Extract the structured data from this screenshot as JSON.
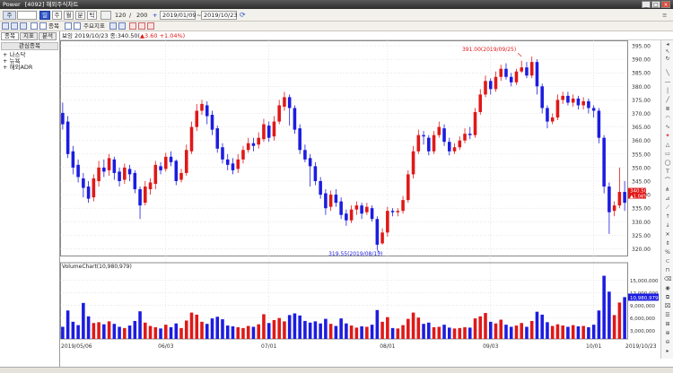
{
  "window": {
    "title": "[4092] 해외주식차트",
    "logo": "Power"
  },
  "toolbar": {
    "code_btn": "주",
    "day": "일",
    "week": "주",
    "month": "월",
    "minute": "분",
    "tick": "틱",
    "count": "120",
    "total": "200",
    "date_from": "2019/01/09",
    "date_to": "2019/10/23"
  },
  "toolbar2": {
    "labels": [
      "주요지표",
      "종목"
    ]
  },
  "sidebar": {
    "tabs": [
      "종목",
      "지표",
      "분석"
    ],
    "header": "관심종목",
    "items": [
      "나스닥",
      "뉴욕",
      "해외ADR"
    ]
  },
  "infobar": {
    "name": "보잉",
    "info": "2019/10/23 종:340.50(",
    "change": "▲3.60 +1.04%)"
  },
  "chart_data": {
    "type": "candlestick",
    "price_axis": {
      "ticks": [
        395.0,
        390.0,
        385.0,
        380.0,
        375.0,
        370.0,
        365.0,
        360.0,
        355.0,
        350.0,
        345.0,
        340.0,
        335.0,
        330.0,
        325.0,
        320.0
      ],
      "range": [
        317.5,
        397
      ]
    },
    "volume_axis": {
      "ticks": [
        "15,000,000",
        "12,000,000",
        "9,000,000",
        "6,000,000",
        "3,000,000"
      ],
      "range": [
        1000000,
        17500000
      ]
    },
    "x_labels": [
      "2019/05/06",
      "06/03",
      "07/01",
      "08/01",
      "09/03",
      "10/01",
      "2019/10/23"
    ],
    "label_positions": [
      0,
      20,
      40,
      63,
      83,
      103,
      123
    ],
    "annotations": {
      "high": "391.00(2019/09/25)",
      "low": "319.55(2019/08/15)"
    },
    "last_price": {
      "value": "340.50",
      "change": "▲1.04%"
    },
    "volume_title": "VolumeChart(10,980,979)",
    "last_volume": "10,980,979",
    "colors": {
      "up": "#e01818",
      "down": "#1c1ce0"
    },
    "candles": [
      [
        370.2,
        366.0,
        374.0,
        364.0
      ],
      [
        367.0,
        355.0,
        369.0,
        353.5
      ],
      [
        356.0,
        350.0,
        358.0,
        347.5
      ],
      [
        351.0,
        346.5,
        353.0,
        344.5
      ],
      [
        346.0,
        342.5,
        348.0,
        339.0
      ],
      [
        343.0,
        338.5,
        345.0,
        337.0
      ],
      [
        339.0,
        346.0,
        347.5,
        337.5
      ],
      [
        345.0,
        350.0,
        352.5,
        343.0
      ],
      [
        350.0,
        348.5,
        353.0,
        346.5
      ],
      [
        349.0,
        353.5,
        355.0,
        347.0
      ],
      [
        353.0,
        348.0,
        354.0,
        345.5
      ],
      [
        348.5,
        345.0,
        350.0,
        343.0
      ],
      [
        345.5,
        350.0,
        351.5,
        344.0
      ],
      [
        349.5,
        347.5,
        351.0,
        345.0
      ],
      [
        348.0,
        342.0,
        349.0,
        340.5
      ],
      [
        342.0,
        336.0,
        343.0,
        331.0
      ],
      [
        337.0,
        343.0,
        345.0,
        336.0
      ],
      [
        342.0,
        344.5,
        346.0,
        340.0
      ],
      [
        344.0,
        351.0,
        352.5,
        342.0
      ],
      [
        350.5,
        349.0,
        352.0,
        347.5
      ],
      [
        349.5,
        354.0,
        355.5,
        348.5
      ],
      [
        354.0,
        352.0,
        356.0,
        350.5
      ],
      [
        352.5,
        345.0,
        353.0,
        343.5
      ],
      [
        345.5,
        348.0,
        349.5,
        344.5
      ],
      [
        348.0,
        356.5,
        358.5,
        347.0
      ],
      [
        356.0,
        365.0,
        367.0,
        355.0
      ],
      [
        365.0,
        371.0,
        373.5,
        363.5
      ],
      [
        371.0,
        373.5,
        375.0,
        369.5
      ],
      [
        373.0,
        369.0,
        374.5,
        366.0
      ],
      [
        369.5,
        364.0,
        371.0,
        362.0
      ],
      [
        364.5,
        357.0,
        365.5,
        355.5
      ],
      [
        357.5,
        353.0,
        359.0,
        351.5
      ],
      [
        353.0,
        351.0,
        355.0,
        349.0
      ],
      [
        351.5,
        349.0,
        353.5,
        347.5
      ],
      [
        349.5,
        353.0,
        355.0,
        348.0
      ],
      [
        353.0,
        356.5,
        358.0,
        351.5
      ],
      [
        356.5,
        359.0,
        361.0,
        355.5
      ],
      [
        359.0,
        358.0,
        361.0,
        356.0
      ],
      [
        358.5,
        361.0,
        363.0,
        357.0
      ],
      [
        360.5,
        366.0,
        368.0,
        359.5
      ],
      [
        365.5,
        361.0,
        367.0,
        359.5
      ],
      [
        361.5,
        367.0,
        369.0,
        360.0
      ],
      [
        367.0,
        373.0,
        375.0,
        366.0
      ],
      [
        372.5,
        376.0,
        378.0,
        371.0
      ],
      [
        376.0,
        372.0,
        377.0,
        365.5
      ],
      [
        372.0,
        364.0,
        373.0,
        362.5
      ],
      [
        364.5,
        356.5,
        366.0,
        355.0
      ],
      [
        356.5,
        353.0,
        358.5,
        352.0
      ],
      [
        353.5,
        350.5,
        355.0,
        343.0
      ],
      [
        350.5,
        345.0,
        352.0,
        343.5
      ],
      [
        345.0,
        340.0,
        346.5,
        338.5
      ],
      [
        340.5,
        335.0,
        342.0,
        332.5
      ],
      [
        335.5,
        340.0,
        341.5,
        334.0
      ],
      [
        340.0,
        337.0,
        342.0,
        335.5
      ],
      [
        337.5,
        332.5,
        339.0,
        331.0
      ],
      [
        333.0,
        330.5,
        334.5,
        328.5
      ],
      [
        330.5,
        334.5,
        336.0,
        329.5
      ],
      [
        334.5,
        336.0,
        337.5,
        332.5
      ],
      [
        336.0,
        333.0,
        337.0,
        331.0
      ],
      [
        333.5,
        335.5,
        337.0,
        332.5
      ],
      [
        335.0,
        331.0,
        336.0,
        330.0
      ],
      [
        331.0,
        321.5,
        332.0,
        319.6
      ],
      [
        322.0,
        326.0,
        327.5,
        321.5
      ],
      [
        326.0,
        334.0,
        335.5,
        324.5
      ],
      [
        334.0,
        333.5,
        335.0,
        332.0
      ],
      [
        333.5,
        334.0,
        335.0,
        332.0
      ],
      [
        334.0,
        338.0,
        339.5,
        333.0
      ],
      [
        338.0,
        347.5,
        349.0,
        337.0
      ],
      [
        347.5,
        356.0,
        358.0,
        346.0
      ],
      [
        356.0,
        362.0,
        364.0,
        355.0
      ],
      [
        362.0,
        361.5,
        363.5,
        358.5
      ],
      [
        361.0,
        356.0,
        362.0,
        354.5
      ],
      [
        356.0,
        362.0,
        363.5,
        355.0
      ],
      [
        362.0,
        365.0,
        367.0,
        361.0
      ],
      [
        364.5,
        359.5,
        366.0,
        358.0
      ],
      [
        359.5,
        356.0,
        361.0,
        354.5
      ],
      [
        356.0,
        357.5,
        359.0,
        355.0
      ],
      [
        357.5,
        360.0,
        361.5,
        356.5
      ],
      [
        360.0,
        362.5,
        364.5,
        359.0
      ],
      [
        362.5,
        362.0,
        365.0,
        360.5
      ],
      [
        362.0,
        370.5,
        372.0,
        361.0
      ],
      [
        370.5,
        377.0,
        379.0,
        369.5
      ],
      [
        377.0,
        382.0,
        384.0,
        376.0
      ],
      [
        382.0,
        379.0,
        383.0,
        377.0
      ],
      [
        379.0,
        383.5,
        385.5,
        378.0
      ],
      [
        383.5,
        386.5,
        388.0,
        382.0
      ],
      [
        386.5,
        383.5,
        388.5,
        382.5
      ],
      [
        383.5,
        381.5,
        385.0,
        380.0
      ],
      [
        381.5,
        385.5,
        386.5,
        380.5
      ],
      [
        385.5,
        387.0,
        389.5,
        385.0
      ],
      [
        387.0,
        384.0,
        389.0,
        383.0
      ],
      [
        384.0,
        389.0,
        391.0,
        383.0
      ],
      [
        389.0,
        380.0,
        390.0,
        377.0
      ],
      [
        380.0,
        372.0,
        381.0,
        370.0
      ],
      [
        372.0,
        367.0,
        373.0,
        364.5
      ],
      [
        367.0,
        368.5,
        370.0,
        366.0
      ],
      [
        368.5,
        375.0,
        377.0,
        367.5
      ],
      [
        375.0,
        376.5,
        378.0,
        373.5
      ],
      [
        376.5,
        374.0,
        378.0,
        373.0
      ],
      [
        374.0,
        375.5,
        377.0,
        372.5
      ],
      [
        375.5,
        373.0,
        376.5,
        371.5
      ],
      [
        373.0,
        374.5,
        376.0,
        371.5
      ],
      [
        374.5,
        372.0,
        375.5,
        370.0
      ],
      [
        372.0,
        371.0,
        373.0,
        368.5
      ],
      [
        371.0,
        361.0,
        372.0,
        359.0
      ],
      [
        361.0,
        343.0,
        362.0,
        340.5
      ],
      [
        343.0,
        333.5,
        344.5,
        325.5
      ],
      [
        334.0,
        336.0,
        337.5,
        332.0
      ],
      [
        336.0,
        341.0,
        350.0,
        335.0
      ],
      [
        341.0,
        337.0,
        345.0,
        334.0
      ]
    ],
    "volumes": [
      3.9,
      7.8,
      5.1,
      4.3,
      9.6,
      6.4,
      4.8,
      5.0,
      4.5,
      5.2,
      4.6,
      3.9,
      3.6,
      4.2,
      5.3,
      7.6,
      4.9,
      4.1,
      3.8,
      3.5,
      4.4,
      3.8,
      4.7,
      3.6,
      5.4,
      7.3,
      6.8,
      5.1,
      4.6,
      5.9,
      6.3,
      5.7,
      4.2,
      4.0,
      3.8,
      3.6,
      4.1,
      3.9,
      4.5,
      6.9,
      4.8,
      5.5,
      6.0,
      5.2,
      6.7,
      7.1,
      6.6,
      5.3,
      4.9,
      5.2,
      4.7,
      5.8,
      4.6,
      4.1,
      5.9,
      4.7,
      4.2,
      3.7,
      4.0,
      3.9,
      4.4,
      7.9,
      5.1,
      6.2,
      3.6,
      3.5,
      4.3,
      5.8,
      7.3,
      6.1,
      4.6,
      4.9,
      3.8,
      3.9,
      4.4,
      3.7,
      3.5,
      3.6,
      3.8,
      3.7,
      5.9,
      6.4,
      7.2,
      5.1,
      4.7,
      5.6,
      4.4,
      3.9,
      4.2,
      4.8,
      3.9,
      5.3,
      7.5,
      6.8,
      5.0,
      4.1,
      4.5,
      4.2,
      3.9,
      4.3,
      4.0,
      4.1,
      3.8,
      4.4,
      7.8,
      16.1,
      12.3,
      6.7,
      9.7,
      11.0
    ]
  }
}
